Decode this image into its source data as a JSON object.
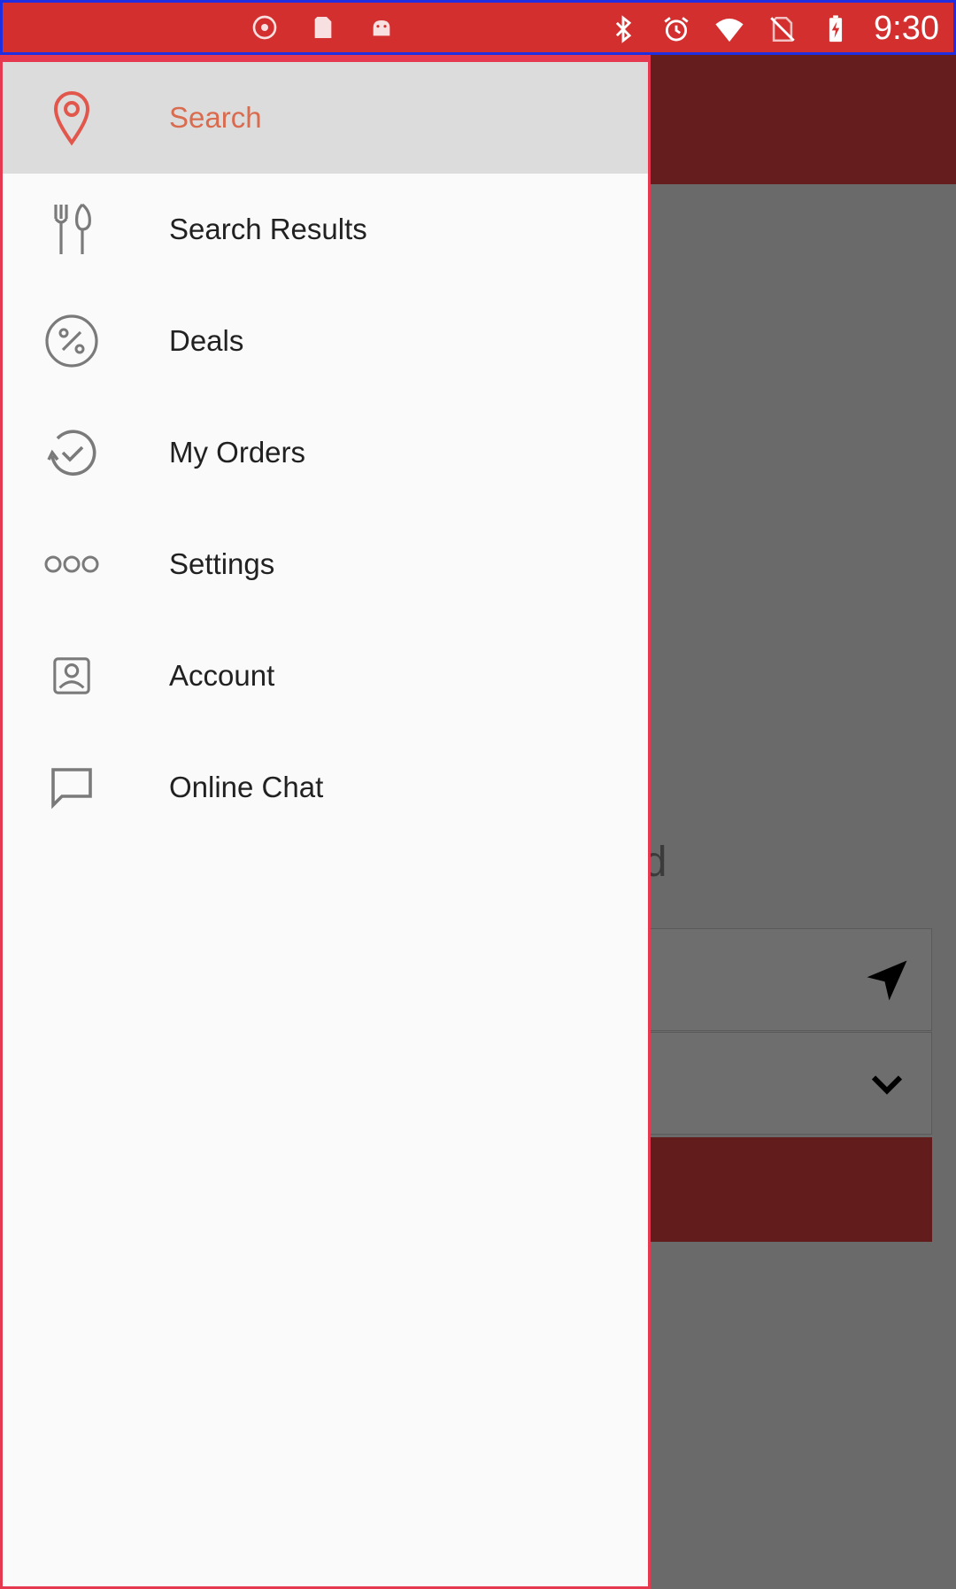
{
  "status_bar": {
    "time": "9:30",
    "icons": [
      "location-icon",
      "sd-card-icon",
      "android-icon",
      "bluetooth-icon",
      "alarm-icon",
      "wifi-icon",
      "no-sim-icon",
      "battery-charging-icon"
    ]
  },
  "drawer": {
    "items": [
      {
        "label": "Search",
        "icon": "map-pin-icon",
        "selected": true
      },
      {
        "label": "Search Results",
        "icon": "fork-knife-icon",
        "selected": false
      },
      {
        "label": "Deals",
        "icon": "percent-icon",
        "selected": false
      },
      {
        "label": "My Orders",
        "icon": "history-clock-icon",
        "selected": false
      },
      {
        "label": "Settings",
        "icon": "dots-icon",
        "selected": false
      },
      {
        "label": "Account",
        "icon": "account-icon",
        "selected": false
      },
      {
        "label": "Online Chat",
        "icon": "chat-icon",
        "selected": false
      }
    ]
  },
  "background": {
    "heading_fragment": "od"
  },
  "colors": {
    "status_bar": "#d32f2f",
    "accent": "#d96b4f",
    "app_bar_dimmed": "#651d1d"
  }
}
